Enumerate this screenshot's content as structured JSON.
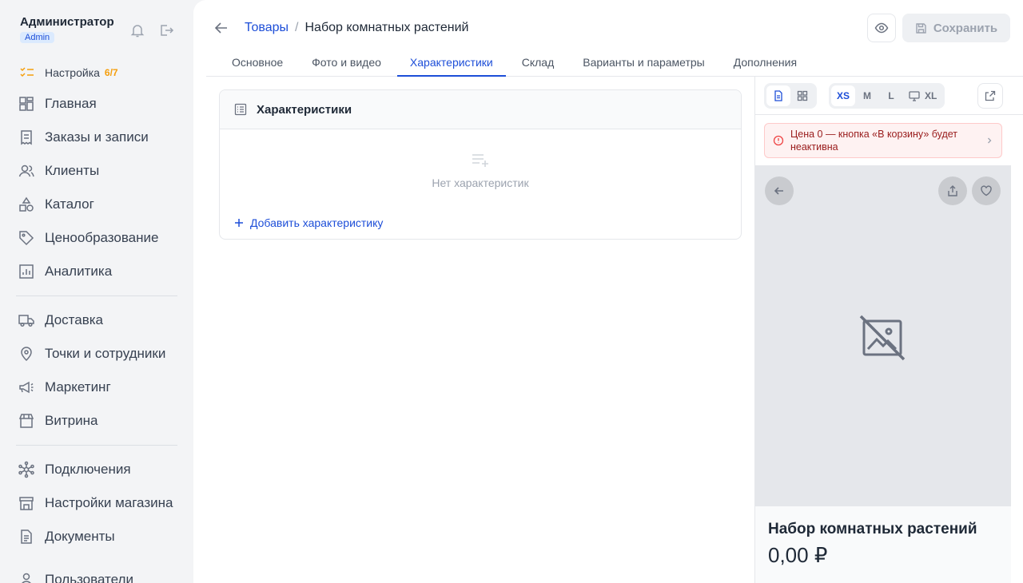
{
  "user": {
    "name": "Администратор",
    "role": "Admin"
  },
  "setup": {
    "label": "Настройка",
    "progress": "6/7"
  },
  "nav": {
    "group1": [
      "Главная",
      "Заказы и записи",
      "Клиенты",
      "Каталог",
      "Ценообразование",
      "Аналитика"
    ],
    "group2": [
      "Доставка",
      "Точки и сотрудники",
      "Маркетинг",
      "Витрина"
    ],
    "group3": [
      "Подключения",
      "Настройки магазина",
      "Документы",
      "Пользователи"
    ]
  },
  "breadcrumb": {
    "parent": "Товары",
    "separator": "/",
    "current": "Набор комнатных растений"
  },
  "header": {
    "save_label": "Сохранить"
  },
  "tabs": [
    "Основное",
    "Фото и видео",
    "Характеристики",
    "Склад",
    "Варианты и параметры",
    "Дополнения"
  ],
  "active_tab": "Характеристики",
  "characteristics": {
    "title": "Характеристики",
    "empty_text": "Нет характеристик",
    "add_label": "Добавить характеристику"
  },
  "preview": {
    "sizes": [
      "XS",
      "M",
      "L",
      "XL"
    ],
    "selected_size": "XS",
    "warning": "Цена 0 — кнопка «В корзину» будет неактивна",
    "product_name": "Набор комнатных растений",
    "price": "0,00 ₽"
  },
  "colors": {
    "accent": "#1d4ed8",
    "warning": "#f59e0b",
    "danger": "#ef4444"
  }
}
